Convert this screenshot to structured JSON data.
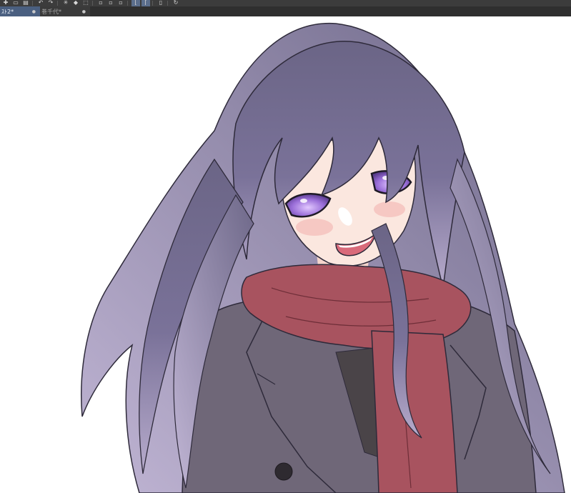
{
  "toolbar": {
    "icons": [
      "new-icon",
      "open-icon",
      "save-icon",
      "undo-icon",
      "redo-icon",
      "loading-icon",
      "fill-icon",
      "transform-icon",
      "crop-icon",
      "select-icon",
      "select-2-icon",
      "ruler-icon",
      "ruler-2-icon",
      "device-icon",
      "rotate-icon"
    ]
  },
  "tabs": [
    {
      "label": "ｽﾄ2*",
      "active": true
    },
    {
      "label": "巻千代*",
      "active": false
    }
  ],
  "canvas": {
    "background": "#ffffff",
    "illustration": "anime-girl-red-scarf"
  },
  "colors": {
    "hair": "#6b6586",
    "hair_light": "#b3a7c8",
    "scarf": "#a8535f",
    "coat": "#6f6778",
    "eyes": "#9a6ed8",
    "skin": "#fbe7df",
    "toolbar_bg": "#3c3c3c",
    "tab_active": "#4a5f80"
  }
}
